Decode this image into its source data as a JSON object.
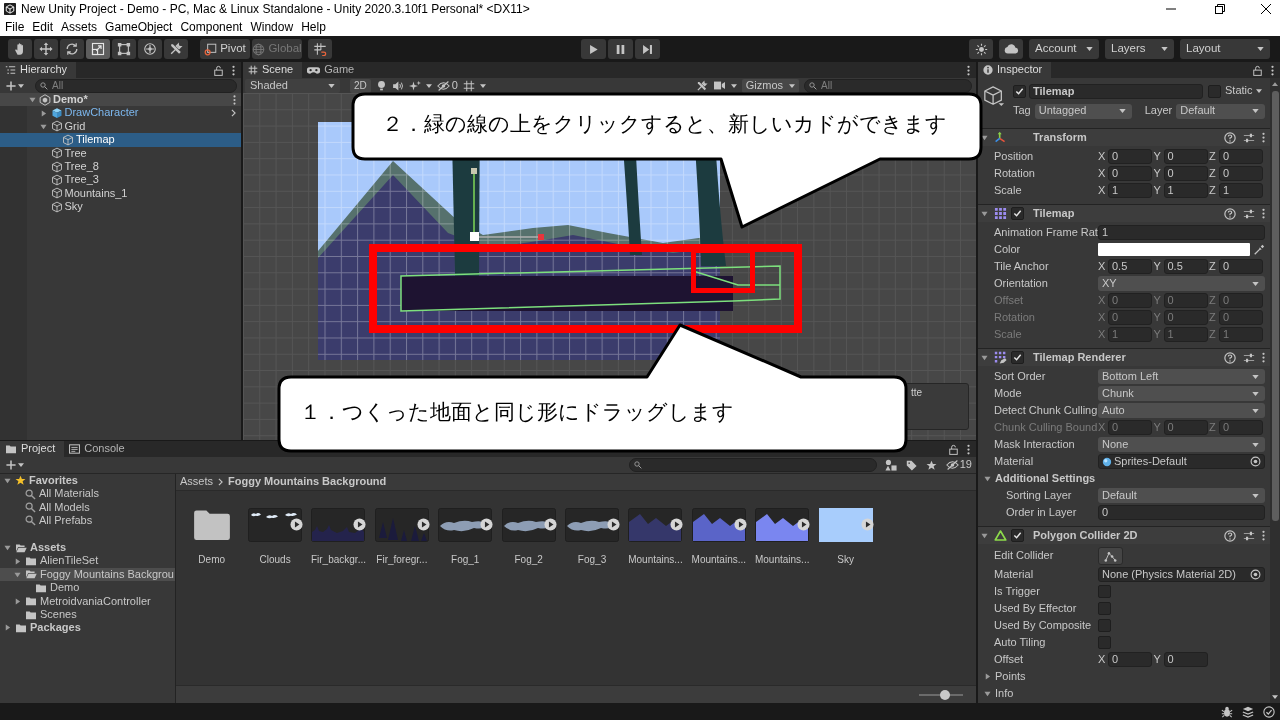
{
  "window": {
    "title": "New Unity Project - Demo - PC, Mac & Linux Standalone - Unity 2020.3.10f1 Personal* <DX11>"
  },
  "menu": [
    "File",
    "Edit",
    "Assets",
    "GameObject",
    "Component",
    "Window",
    "Help"
  ],
  "toolbar": {
    "tools": [
      {
        "kind": "hand",
        "selected": false
      },
      {
        "kind": "move",
        "selected": false
      },
      {
        "kind": "rotate",
        "selected": false
      },
      {
        "kind": "scale",
        "selected": true
      },
      {
        "kind": "rect",
        "selected": false
      },
      {
        "kind": "transform",
        "selected": false
      },
      {
        "kind": "custom",
        "selected": false
      }
    ],
    "handles": [
      {
        "kind": "pivot",
        "label": "Pivot",
        "disabled": false
      },
      {
        "kind": "global",
        "label": "Global",
        "disabled": true
      }
    ],
    "playback": [
      {
        "kind": "play"
      },
      {
        "kind": "pause"
      },
      {
        "kind": "step"
      }
    ],
    "menus": [
      "Account",
      "Layers",
      "Layout"
    ]
  },
  "hierarchy": {
    "tab": {
      "label": "Hierarchy",
      "selected": true
    },
    "search_placeholder": "All",
    "items": [
      {
        "label": "Demo*",
        "kind": "scene",
        "selected": false,
        "expanded": true,
        "children": [
          {
            "label": "DrawCharacter",
            "kind": "prefab",
            "selected": false,
            "expanded": false
          },
          {
            "label": "Grid",
            "kind": "object",
            "selected": false,
            "expanded": true,
            "children": [
              {
                "label": "Tilemap",
                "kind": "object",
                "selected": true
              }
            ]
          },
          {
            "label": "Tree",
            "kind": "object",
            "selected": false
          },
          {
            "label": "Tree_8",
            "kind": "object",
            "selected": false
          },
          {
            "label": "Tree_3",
            "kind": "object",
            "selected": false
          },
          {
            "label": "Mountains_1",
            "kind": "object",
            "selected": false
          },
          {
            "label": "Sky",
            "kind": "object",
            "selected": false
          }
        ]
      }
    ]
  },
  "scene": {
    "tabs": [
      {
        "label": "Scene",
        "kind": "scene",
        "selected": true
      },
      {
        "label": "Game",
        "kind": "game",
        "selected": false
      }
    ],
    "shading": "Shaded",
    "view_2d": "2D",
    "hidden_count": "0",
    "gizmos": "Gizmos",
    "search_placeholder": "All",
    "overlay_title": "tte",
    "callouts": [
      {
        "text": "２．緑の線の上をクリックすると、新しいカドができます"
      },
      {
        "text": "１．つくった地面と同じ形にドラッグします"
      }
    ]
  },
  "inspector": {
    "tab": {
      "label": "Inspector",
      "selected": true
    },
    "object": {
      "active": true,
      "name": "Tilemap",
      "static": {
        "label": "Static",
        "checked": false
      },
      "tag": {
        "label": "Tag",
        "value": "Untagged"
      },
      "layer": {
        "label": "Layer",
        "value": "Default"
      }
    },
    "components": [
      {
        "kind": "transform",
        "title": "Transform",
        "expanded": true,
        "rows": [
          {
            "kind": "vector",
            "label": "Position",
            "disabled": false,
            "fields": [
              {
                "axis": "X",
                "value": "0"
              },
              {
                "axis": "Y",
                "value": "0"
              },
              {
                "axis": "Z",
                "value": "0"
              }
            ]
          },
          {
            "kind": "vector",
            "label": "Rotation",
            "disabled": false,
            "fields": [
              {
                "axis": "X",
                "value": "0"
              },
              {
                "axis": "Y",
                "value": "0"
              },
              {
                "axis": "Z",
                "value": "0"
              }
            ]
          },
          {
            "kind": "vector",
            "label": "Scale",
            "disabled": false,
            "fields": [
              {
                "axis": "X",
                "value": "1"
              },
              {
                "axis": "Y",
                "value": "1"
              },
              {
                "axis": "Z",
                "value": "1"
              }
            ]
          }
        ]
      },
      {
        "kind": "tilemap",
        "title": "Tilemap",
        "enabled": true,
        "expanded": true,
        "rows": [
          {
            "kind": "number",
            "label": "Animation Frame Rat",
            "disabled": false,
            "value": "1"
          },
          {
            "kind": "color",
            "label": "Color",
            "disabled": false,
            "color": "#ffffff"
          },
          {
            "kind": "vector",
            "label": "Tile Anchor",
            "disabled": false,
            "fields": [
              {
                "axis": "X",
                "value": "0.5"
              },
              {
                "axis": "Y",
                "value": "0.5"
              },
              {
                "axis": "Z",
                "value": "0"
              }
            ]
          },
          {
            "kind": "dropdown",
            "label": "Orientation",
            "disabled": false,
            "value": "XY"
          },
          {
            "kind": "vector",
            "label": "Offset",
            "disabled": true,
            "fields": [
              {
                "axis": "X",
                "value": "0"
              },
              {
                "axis": "Y",
                "value": "0"
              },
              {
                "axis": "Z",
                "value": "0"
              }
            ]
          },
          {
            "kind": "vector",
            "label": "Rotation",
            "disabled": true,
            "fields": [
              {
                "axis": "X",
                "value": "0"
              },
              {
                "axis": "Y",
                "value": "0"
              },
              {
                "axis": "Z",
                "value": "0"
              }
            ]
          },
          {
            "kind": "vector",
            "label": "Scale",
            "disabled": true,
            "fields": [
              {
                "axis": "X",
                "value": "1"
              },
              {
                "axis": "Y",
                "value": "1"
              },
              {
                "axis": "Z",
                "value": "1"
              }
            ]
          }
        ]
      },
      {
        "kind": "tilemap_renderer",
        "title": "Tilemap Renderer",
        "enabled": true,
        "expanded": true,
        "rows": [
          {
            "kind": "dropdown",
            "label": "Sort Order",
            "disabled": false,
            "value": "Bottom Left"
          },
          {
            "kind": "dropdown",
            "label": "Mode",
            "disabled": false,
            "value": "Chunk"
          },
          {
            "kind": "dropdown",
            "label": "Detect Chunk Culling",
            "disabled": false,
            "value": "Auto"
          },
          {
            "kind": "vector",
            "label": "Chunk Culling Bound",
            "disabled": true,
            "fields": [
              {
                "axis": "X",
                "value": "0"
              },
              {
                "axis": "Y",
                "value": "0"
              },
              {
                "axis": "Z",
                "value": "0"
              }
            ]
          },
          {
            "kind": "dropdown",
            "label": "Mask Interaction",
            "disabled": false,
            "value": "None"
          },
          {
            "kind": "material",
            "label": "Material",
            "disabled": false,
            "value": "Sprites-Default"
          },
          {
            "kind": "section",
            "label": "Additional Settings",
            "disabled": false,
            "expanded": true,
            "children": [
              {
                "kind": "dropdown",
                "label": "Sorting Layer",
                "disabled": false,
                "value": "Default"
              },
              {
                "kind": "number",
                "label": "Order in Layer",
                "disabled": false,
                "value": "0"
              }
            ]
          }
        ]
      },
      {
        "kind": "polygon_collider",
        "title": "Polygon Collider 2D",
        "enabled": true,
        "expanded": true,
        "rows": [
          {
            "kind": "button",
            "label": "Edit Collider",
            "disabled": false
          },
          {
            "kind": "object",
            "label": "Material",
            "disabled": false,
            "value": "None (Physics Material 2D)"
          },
          {
            "kind": "checkbox",
            "label": "Is Trigger",
            "disabled": false,
            "checked": false
          },
          {
            "kind": "checkbox",
            "label": "Used By Effector",
            "disabled": false,
            "checked": false
          },
          {
            "kind": "checkbox",
            "label": "Used By Composite",
            "disabled": false,
            "checked": false
          },
          {
            "kind": "checkbox",
            "label": "Auto Tiling",
            "disabled": false,
            "checked": false
          },
          {
            "kind": "vector",
            "label": "Offset",
            "disabled": false,
            "fields": [
              {
                "axis": "X",
                "value": "0"
              },
              {
                "axis": "Y",
                "value": "0"
              }
            ]
          },
          {
            "kind": "foldout",
            "label": "Points",
            "disabled": false,
            "expanded": false
          },
          {
            "kind": "foldout",
            "label": "Info",
            "disabled": false,
            "expanded": true
          }
        ]
      }
    ]
  },
  "project": {
    "tabs": [
      {
        "label": "Project",
        "kind": "project",
        "selected": true
      },
      {
        "label": "Console",
        "kind": "console",
        "selected": false
      }
    ],
    "hidden_count": "19",
    "tree": [
      {
        "label": "Favorites",
        "kind": "favorites",
        "selected": false,
        "expanded": true,
        "children": [
          {
            "label": "All Materials",
            "kind": "search",
            "selected": false
          },
          {
            "label": "All Models",
            "kind": "search",
            "selected": false
          },
          {
            "label": "All Prefabs",
            "kind": "search",
            "selected": false
          }
        ]
      },
      {
        "label": "Assets",
        "kind": "folder",
        "selected": false,
        "expanded": true,
        "children": [
          {
            "label": "AlienTileSet",
            "kind": "folder",
            "selected": false,
            "expanded": false
          },
          {
            "label": "Foggy Mountains Backgrou",
            "kind": "folder",
            "selected": true,
            "expanded": true,
            "children": [
              {
                "label": "Demo",
                "kind": "folder",
                "selected": false
              }
            ]
          },
          {
            "label": "MetroidvaniaController",
            "kind": "folder",
            "selected": false,
            "expanded": false
          },
          {
            "label": "Scenes",
            "kind": "folder",
            "selected": false
          }
        ]
      },
      {
        "label": "Packages",
        "kind": "folder",
        "selected": false,
        "expanded": false
      }
    ],
    "breadcrumb": [
      "Assets",
      "Foggy Mountains Background"
    ],
    "assets": [
      {
        "label": "Demo",
        "kind": "folder"
      },
      {
        "label": "Clouds",
        "kind": "clouds"
      },
      {
        "label": "Fir_backgr...",
        "kind": "firs",
        "color": "#24234c"
      },
      {
        "label": "Fir_foregr...",
        "kind": "fir_trees"
      },
      {
        "label": "Fog_1",
        "kind": "fog"
      },
      {
        "label": "Fog_2",
        "kind": "fog"
      },
      {
        "label": "Fog_3",
        "kind": "fog"
      },
      {
        "label": "Mountains...",
        "kind": "mountains",
        "color": "#35376a"
      },
      {
        "label": "Mountains...",
        "kind": "mountains",
        "color": "#5a64c8"
      },
      {
        "label": "Mountains...",
        "kind": "mountains",
        "color": "#7a86f0"
      },
      {
        "label": "Sky",
        "kind": "sky",
        "color": "#a8cdfc"
      }
    ],
    "zoom": {
      "level": 0.6
    }
  }
}
